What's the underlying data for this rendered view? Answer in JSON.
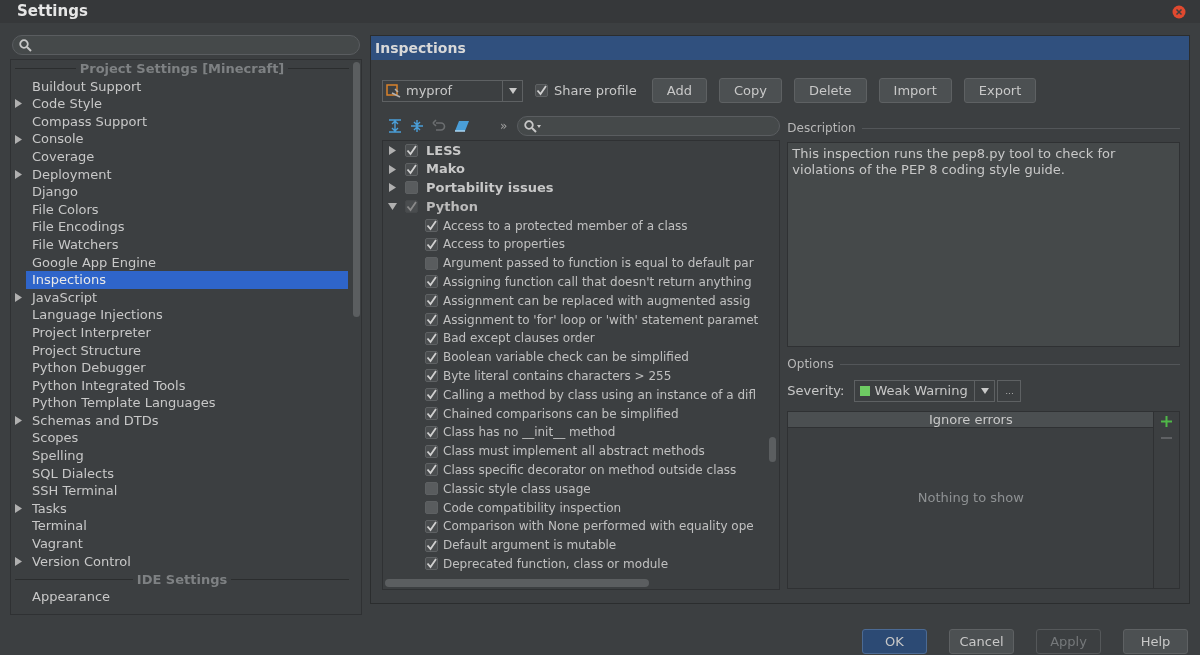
{
  "window": {
    "title": "Settings"
  },
  "sidebar": {
    "items": [
      {
        "kind": "section",
        "label": "Project Settings [Minecraft]"
      },
      {
        "kind": "item",
        "label": "Buildout Support",
        "expandable": false,
        "selected": false
      },
      {
        "kind": "item",
        "label": "Code Style",
        "expandable": true,
        "selected": false
      },
      {
        "kind": "item",
        "label": "Compass Support",
        "expandable": false,
        "selected": false
      },
      {
        "kind": "item",
        "label": "Console",
        "expandable": true,
        "selected": false
      },
      {
        "kind": "item",
        "label": "Coverage",
        "expandable": false,
        "selected": false
      },
      {
        "kind": "item",
        "label": "Deployment",
        "expandable": true,
        "selected": false
      },
      {
        "kind": "item",
        "label": "Django",
        "expandable": false,
        "selected": false
      },
      {
        "kind": "item",
        "label": "File Colors",
        "expandable": false,
        "selected": false
      },
      {
        "kind": "item",
        "label": "File Encodings",
        "expandable": false,
        "selected": false
      },
      {
        "kind": "item",
        "label": "File Watchers",
        "expandable": false,
        "selected": false
      },
      {
        "kind": "item",
        "label": "Google App Engine",
        "expandable": false,
        "selected": false
      },
      {
        "kind": "item",
        "label": "Inspections",
        "expandable": false,
        "selected": true
      },
      {
        "kind": "item",
        "label": "JavaScript",
        "expandable": true,
        "selected": false
      },
      {
        "kind": "item",
        "label": "Language Injections",
        "expandable": false,
        "selected": false
      },
      {
        "kind": "item",
        "label": "Project Interpreter",
        "expandable": false,
        "selected": false
      },
      {
        "kind": "item",
        "label": "Project Structure",
        "expandable": false,
        "selected": false
      },
      {
        "kind": "item",
        "label": "Python Debugger",
        "expandable": false,
        "selected": false
      },
      {
        "kind": "item",
        "label": "Python Integrated Tools",
        "expandable": false,
        "selected": false
      },
      {
        "kind": "item",
        "label": "Python Template Languages",
        "expandable": false,
        "selected": false
      },
      {
        "kind": "item",
        "label": "Schemas and DTDs",
        "expandable": true,
        "selected": false
      },
      {
        "kind": "item",
        "label": "Scopes",
        "expandable": false,
        "selected": false
      },
      {
        "kind": "item",
        "label": "Spelling",
        "expandable": false,
        "selected": false
      },
      {
        "kind": "item",
        "label": "SQL Dialects",
        "expandable": false,
        "selected": false
      },
      {
        "kind": "item",
        "label": "SSH Terminal",
        "expandable": false,
        "selected": false
      },
      {
        "kind": "item",
        "label": "Tasks",
        "expandable": true,
        "selected": false
      },
      {
        "kind": "item",
        "label": "Terminal",
        "expandable": false,
        "selected": false
      },
      {
        "kind": "item",
        "label": "Vagrant",
        "expandable": false,
        "selected": false
      },
      {
        "kind": "item",
        "label": "Version Control",
        "expandable": true,
        "selected": false
      },
      {
        "kind": "section",
        "label": "IDE Settings"
      },
      {
        "kind": "item",
        "label": "Appearance",
        "expandable": false,
        "selected": false
      }
    ]
  },
  "panel": {
    "title": "Inspections",
    "profile": {
      "value": "myprof"
    },
    "share_profile": {
      "label": "Share profile",
      "checked": true
    },
    "buttons": [
      "Add",
      "Copy",
      "Delete",
      "Import",
      "Export"
    ],
    "toolbar_more": "»",
    "tree": [
      {
        "label": "LESS",
        "checked": true,
        "partial": false,
        "expanded": false
      },
      {
        "label": "Mako",
        "checked": true,
        "partial": false,
        "expanded": false
      },
      {
        "label": "Portability issues",
        "checked": false,
        "partial": false,
        "expanded": false
      },
      {
        "label": "Python",
        "checked": true,
        "partial": true,
        "expanded": true,
        "children": [
          {
            "label": "Access to a protected member of a class",
            "checked": true
          },
          {
            "label": "Access to properties",
            "checked": true
          },
          {
            "label": "Argument passed to function is equal to default par",
            "checked": false
          },
          {
            "label": "Assigning function call that doesn't return anything",
            "checked": true
          },
          {
            "label": "Assignment can be replaced with augmented assig",
            "checked": true
          },
          {
            "label": "Assignment to 'for' loop or 'with' statement paramet",
            "checked": true
          },
          {
            "label": "Bad except clauses order",
            "checked": true
          },
          {
            "label": "Boolean variable check can be simplified",
            "checked": true
          },
          {
            "label": "Byte literal contains characters > 255",
            "checked": true
          },
          {
            "label": "Calling a method by class using an instance of a difl",
            "checked": true
          },
          {
            "label": "Chained comparisons can be simplified",
            "checked": true
          },
          {
            "label": "Class has no __init__ method",
            "checked": true
          },
          {
            "label": "Class must implement all abstract methods",
            "checked": true
          },
          {
            "label": "Class specific decorator on method outside class",
            "checked": true
          },
          {
            "label": "Classic style class usage",
            "checked": false
          },
          {
            "label": "Code compatibility inspection",
            "checked": false
          },
          {
            "label": "Comparison with None performed with equality ope",
            "checked": true
          },
          {
            "label": "Default argument is mutable",
            "checked": true
          },
          {
            "label": "Deprecated function, class or module",
            "checked": true
          }
        ]
      }
    ],
    "description": {
      "title": "Description",
      "text": "This inspection runs the pep8.py tool to check for violations of the PEP 8 coding style guide."
    },
    "options": {
      "title": "Options",
      "severity_label": "Severity:",
      "severity": {
        "value": "Weak Warning",
        "color": "#6ecb63"
      },
      "more": "...",
      "list_header": "Ignore errors",
      "empty_text": "Nothing to show"
    }
  },
  "footer": {
    "buttons": [
      {
        "label": "OK",
        "kind": "primary",
        "disabled": false
      },
      {
        "label": "Cancel",
        "kind": "normal",
        "disabled": false
      },
      {
        "label": "Apply",
        "kind": "normal",
        "disabled": true
      },
      {
        "label": "Help",
        "kind": "normal",
        "disabled": false
      }
    ]
  }
}
